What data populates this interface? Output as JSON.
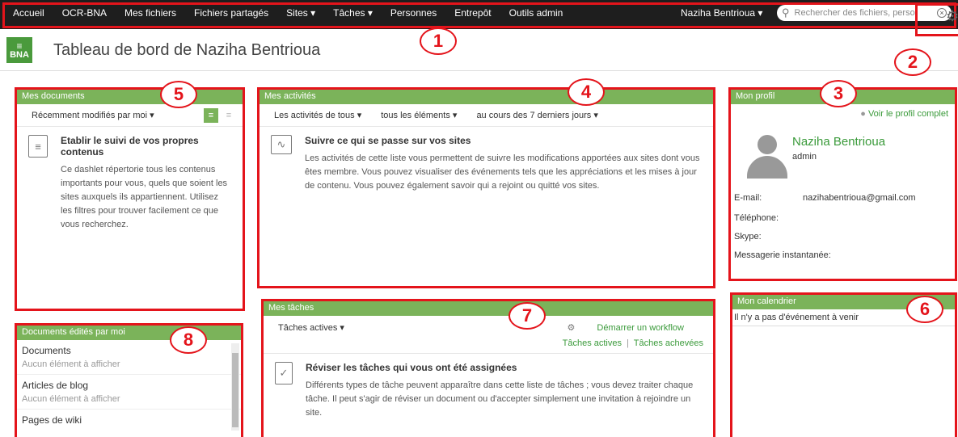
{
  "nav": {
    "items": [
      "Accueil",
      "OCR-BNA",
      "Mes fichiers",
      "Fichiers partagés",
      "Sites ▾",
      "Tâches ▾",
      "Personnes",
      "Entrepôt",
      "Outils admin"
    ],
    "user": "Naziha Bentrioua ▾",
    "search_placeholder": "Rechercher des fichiers, perso"
  },
  "header": {
    "logo_text": "BNA",
    "title": "Tableau de bord de Naziha Bentrioua"
  },
  "badges": [
    "1",
    "2",
    "3",
    "4",
    "5",
    "6",
    "7",
    "8"
  ],
  "my_documents": {
    "title": "Mes documents",
    "filter": "Récemment modifiés par moi ▾",
    "empty_title": "Etablir le suivi de vos propres contenus",
    "empty_text": "Ce dashlet répertorie tous les contenus importants pour vous, quels que soient les sites auxquels ils appartiennent. Utilisez les filtres pour trouver facilement ce que vous recherchez."
  },
  "activities": {
    "title": "Mes activités",
    "filter_who": "Les activités de tous ▾",
    "filter_what": "tous les éléments ▾",
    "filter_when": "au cours des 7 derniers jours ▾",
    "empty_title": "Suivre ce qui se passe sur vos sites",
    "empty_text": "Les activités de cette liste vous permettent de suivre les modifications apportées aux sites dont vous êtes membre. Vous pouvez visualiser des événements tels que les appréciations et les mises à jour de contenu. Vous pouvez également savoir qui a rejoint ou quitté vos sites."
  },
  "profile": {
    "title": "Mon profil",
    "view_link": "Voir le profil complet",
    "name": "Naziha Bentrioua",
    "role": "admin",
    "email_label": "E-mail:",
    "email": "nazihabentrioua@gmail.com",
    "phone_label": "Téléphone:",
    "skype_label": "Skype:",
    "im_label": "Messagerie instantanée:"
  },
  "calendar": {
    "title": "Mon calendrier",
    "empty": "Il n'y a pas d'événement à venir"
  },
  "tasks": {
    "title": "Mes tâches",
    "filter": "Tâches actives ▾",
    "start_workflow": "Démarrer un workflow",
    "active_link": "Tâches actives",
    "separator": "|",
    "done_link": "Tâches achevées",
    "empty_title": "Réviser les tâches qui vous ont été assignées",
    "empty_text": "Différents types de tâche peuvent apparaître dans cette liste de tâches ; vous devez traiter chaque tâche. Il peut s'agir de réviser un document ou d'accepter simplement une invitation à rejoindre un site."
  },
  "edited_docs": {
    "title": "Documents édités par moi",
    "categories": [
      {
        "name": "Documents",
        "empty": "Aucun élément à afficher"
      },
      {
        "name": "Articles de blog",
        "empty": "Aucun élément à afficher"
      },
      {
        "name": "Pages de wiki",
        "empty": ""
      }
    ]
  }
}
